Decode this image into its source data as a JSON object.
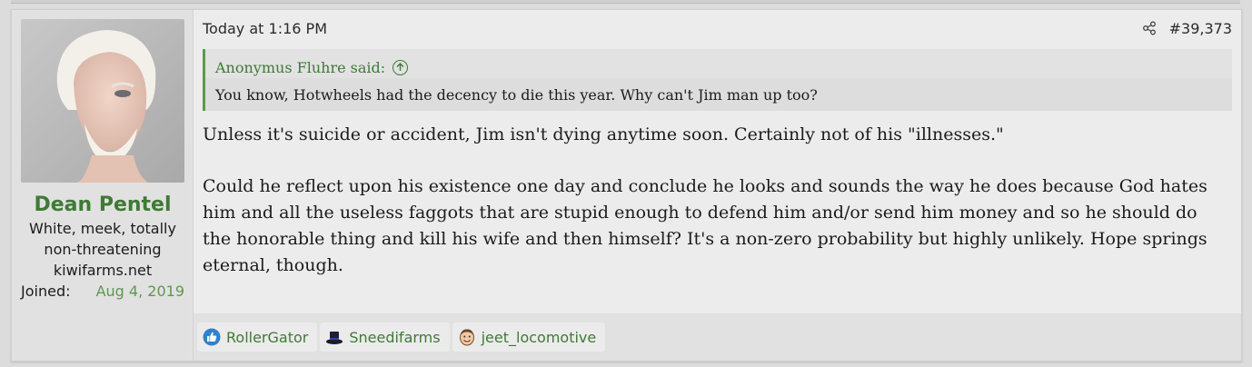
{
  "user": {
    "name": "Dean Pentel",
    "title": "White, meek, totally non-threatening kiwifarms.net",
    "joined_label": "Joined:",
    "joined_value": "Aug 4, 2019"
  },
  "post": {
    "timestamp": "Today at 1:16 PM",
    "number": "#39,373",
    "quote": {
      "author": "Anonymus Fluhre said:",
      "text": "You know, Hotwheels had the decency to die this year. Why can't Jim man up too?"
    },
    "paragraphs": [
      "Unless it's suicide or accident, Jim isn't dying anytime soon. Certainly not of his \"illnesses.\"",
      "Could he reflect upon his existence one day and conclude he looks and sounds the way he does because God hates him and all the useless faggots that are stupid enough to defend him and/or send him money and so he should do the honorable thing and kill his wife and then himself? It's a non-zero probability but highly unlikely. Hope springs eternal, though."
    ]
  },
  "reactions": [
    {
      "icon": "thumbs-up-icon",
      "name": "RollerGator"
    },
    {
      "icon": "top-hat-icon",
      "name": "Sneedifarms"
    },
    {
      "icon": "face-icon",
      "name": "jeet_locomotive"
    }
  ]
}
